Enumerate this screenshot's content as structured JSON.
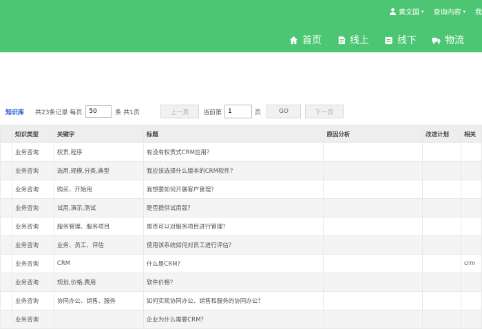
{
  "header": {
    "user": {
      "name": "黄文国",
      "menu": "查询内容",
      "more": "我"
    },
    "nav": [
      {
        "label": "首页",
        "icon": "home-icon"
      },
      {
        "label": "线上",
        "icon": "online-icon"
      },
      {
        "label": "线下",
        "icon": "offline-icon"
      },
      {
        "label": "物流",
        "icon": "truck-icon"
      }
    ],
    "accent": "#4cc672"
  },
  "toolbar": {
    "kb_link": "知识库",
    "total_text": "共23条记录 每页",
    "page_size": "50",
    "per_page_suffix": "条 共1页",
    "prev": "上一页",
    "current_label": "当前第",
    "current_page": "1",
    "page_suffix": "页",
    "go": "GO",
    "next": "下一页"
  },
  "table": {
    "headers": [
      "",
      "知识类型",
      "关键字",
      "标题",
      "原因分析",
      "改进计划",
      "相关"
    ],
    "rows": [
      [
        "",
        "业务咨询",
        "权责,程序",
        "有没有权责式CRM应用？",
        "",
        "",
        ""
      ],
      [
        "",
        "业务咨询",
        "选用,规模,分类,典型",
        "我应该选择什么版本的CRM软件？",
        "",
        "",
        ""
      ],
      [
        "",
        "业务咨询",
        "购买、开始用",
        "我想要如何开展客户管理？",
        "",
        "",
        ""
      ],
      [
        "",
        "业务咨询",
        "试用,演示,测试",
        "是否提供试用版？",
        "",
        "",
        ""
      ],
      [
        "",
        "业务咨询",
        "服务管理、服务项目",
        "是否可以对服务项目进行管理？",
        "",
        "",
        ""
      ],
      [
        "",
        "业务咨询",
        "业务、员工、评估",
        "使用该系统如何对员工进行评估？",
        "",
        "",
        ""
      ],
      [
        "",
        "业务咨询",
        "CRM",
        "什么是CRM?",
        "",
        "",
        "crm"
      ],
      [
        "",
        "业务咨询",
        "规划,价格,费用",
        "软件价格？",
        "",
        "",
        ""
      ],
      [
        "",
        "业务咨询",
        "协同办公、销售、服务",
        "如何实现协同办公、销售和服务的协同办公？",
        "",
        "",
        ""
      ],
      [
        "",
        "业务咨询",
        "",
        "企业为什么需要CRM？",
        "",
        "",
        ""
      ]
    ]
  }
}
